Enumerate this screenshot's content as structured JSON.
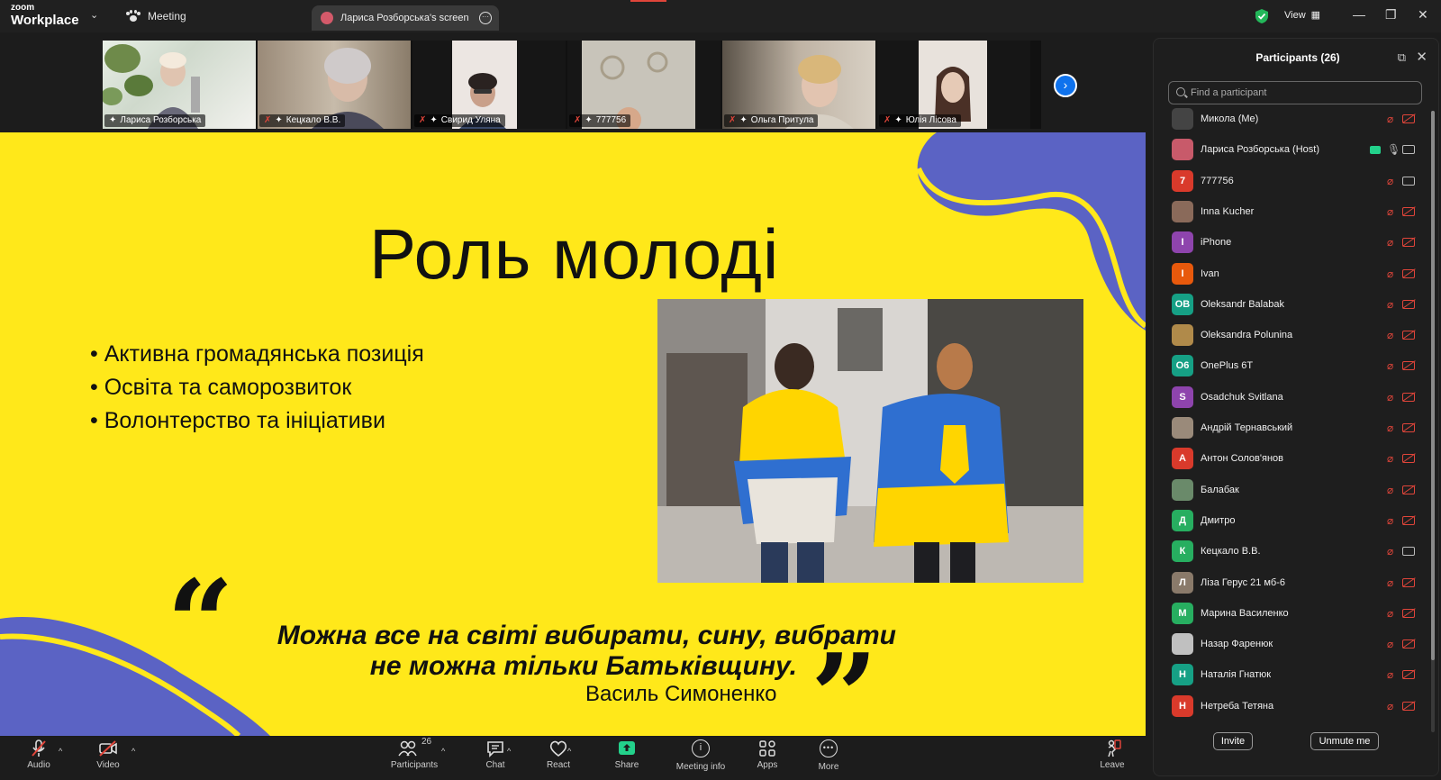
{
  "titlebar": {
    "brand_top": "zoom",
    "brand_bottom": "Workplace",
    "meeting_label": "Meeting",
    "screen_tab_label": "Лариса Розборська's screen",
    "view_label": "View"
  },
  "thumbnails": [
    {
      "name": "Лариса Розборська",
      "muted": false,
      "active": true
    },
    {
      "name": "Кецкало В.В.",
      "muted": true
    },
    {
      "name": "Свирид Уляна",
      "muted": true
    },
    {
      "name": "777756",
      "muted": true
    },
    {
      "name": "Ольга Притула",
      "muted": true
    },
    {
      "name": "Юлія Лісова",
      "muted": true
    }
  ],
  "slide": {
    "title": "Роль молоді",
    "bullets": [
      "• Активна громадянська позиція",
      "• Освіта та саморозвиток",
      "• Волонтерство та ініціативи"
    ],
    "quote_line1": "Можна все на світі вибирати, сину, вибрати",
    "quote_line2": "не можна тільки Батьківщину.",
    "author": "Василь Симоненко",
    "colors": {
      "background": "#ffe81a",
      "wave": "#5b63c4"
    }
  },
  "participants_panel": {
    "title": "Participants (26)",
    "search_placeholder": "Find a participant",
    "invite_label": "Invite",
    "unmute_label": "Unmute me",
    "participants": [
      {
        "name": "Микола (Me)",
        "avatar": "",
        "color": "#444",
        "mic": "off",
        "cam": "off"
      },
      {
        "name": "Лариса Розборська (Host)",
        "avatar": "",
        "color": "#c85a6a",
        "mic": "on",
        "cam": "on",
        "sharing": true
      },
      {
        "name": "777756",
        "avatar": "7",
        "color": "#d93a2b",
        "mic": "off",
        "cam": "on"
      },
      {
        "name": "Inna Kucher",
        "avatar": "",
        "color": "#8a6a5a",
        "mic": "off",
        "cam": "off"
      },
      {
        "name": "iPhone",
        "avatar": "I",
        "color": "#8e44ad",
        "mic": "off",
        "cam": "off"
      },
      {
        "name": "Ivan",
        "avatar": "I",
        "color": "#e8590c",
        "mic": "off",
        "cam": "off"
      },
      {
        "name": "Oleksandr Balabak",
        "avatar": "OB",
        "color": "#16a085",
        "mic": "off",
        "cam": "off"
      },
      {
        "name": "Oleksandra Polunina",
        "avatar": "",
        "color": "#b08a4a",
        "mic": "off",
        "cam": "off"
      },
      {
        "name": "OnePlus 6T",
        "avatar": "O6",
        "color": "#16a085",
        "mic": "off",
        "cam": "off"
      },
      {
        "name": "Osadchuk Svitlana",
        "avatar": "S",
        "color": "#8e44ad",
        "mic": "off",
        "cam": "off"
      },
      {
        "name": "Андрій Тернавський",
        "avatar": "",
        "color": "#9a8a7a",
        "mic": "off",
        "cam": "off"
      },
      {
        "name": "Антон Солов'янов",
        "avatar": "А",
        "color": "#d93a2b",
        "mic": "off",
        "cam": "off"
      },
      {
        "name": "Балабак",
        "avatar": "",
        "color": "#6a8a6a",
        "mic": "off",
        "cam": "off"
      },
      {
        "name": "Дмитро",
        "avatar": "Д",
        "color": "#27ae60",
        "mic": "off",
        "cam": "off"
      },
      {
        "name": "Кецкало В.В.",
        "avatar": "К",
        "color": "#27ae60",
        "mic": "off",
        "cam": "on"
      },
      {
        "name": "Ліза Герус 21 мб-6",
        "avatar": "Л",
        "color": "#8a7a6a",
        "mic": "off",
        "cam": "off"
      },
      {
        "name": "Марина Василенко",
        "avatar": "М",
        "color": "#27ae60",
        "mic": "off",
        "cam": "off"
      },
      {
        "name": "Назар Фаренюк",
        "avatar": "",
        "color": "#c0c0c0",
        "mic": "off",
        "cam": "off"
      },
      {
        "name": "Наталія Гнатюк",
        "avatar": "Н",
        "color": "#16a085",
        "mic": "off",
        "cam": "off"
      },
      {
        "name": "Нетреба Тетяна",
        "avatar": "Н",
        "color": "#d93a2b",
        "mic": "off",
        "cam": "off"
      }
    ]
  },
  "toolbar": {
    "audio": "Audio",
    "video": "Video",
    "participants": "Participants",
    "participants_count": "26",
    "chat": "Chat",
    "react": "React",
    "share": "Share",
    "meeting_info": "Meeting info",
    "apps": "Apps",
    "more": "More",
    "leave": "Leave"
  }
}
